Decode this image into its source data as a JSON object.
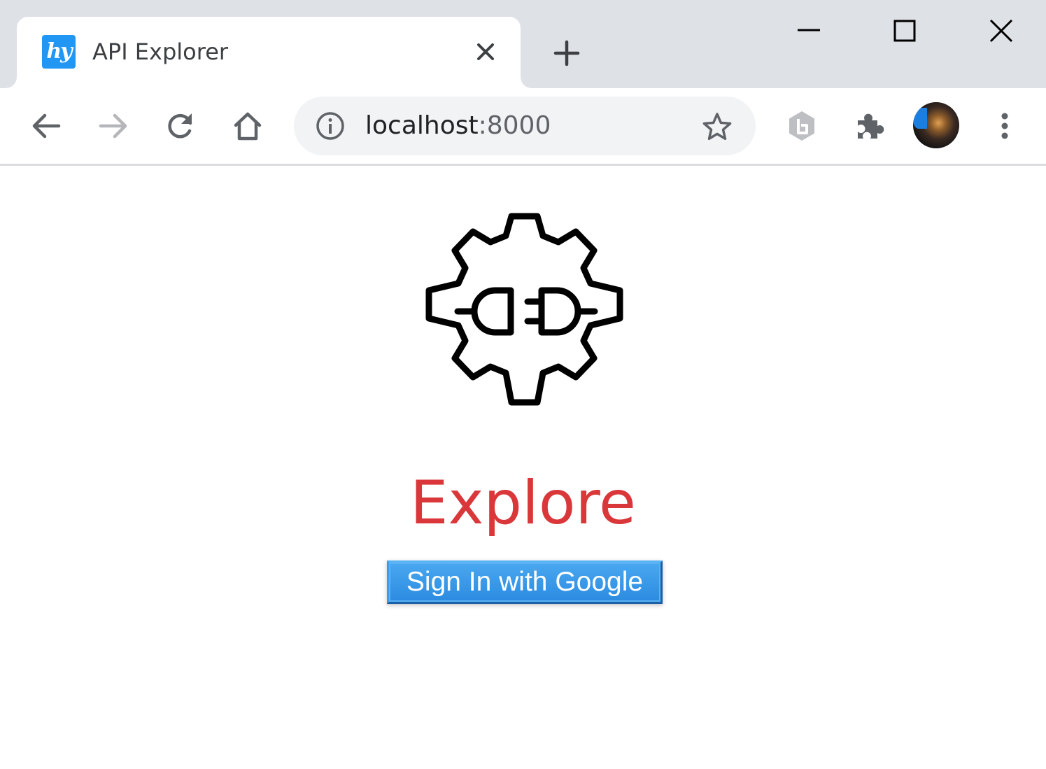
{
  "window": {
    "tab": {
      "title": "API Explorer",
      "favicon_text": "hy",
      "favicon_color": "#2196f3"
    },
    "controls": {
      "minimize_icon": "minimize-icon",
      "maximize_icon": "maximize-icon",
      "close_icon": "close-icon",
      "new_tab_icon": "plus-icon"
    }
  },
  "toolbar": {
    "back_icon": "arrow-left-icon",
    "forward_icon": "arrow-right-icon",
    "reload_icon": "reload-icon",
    "home_icon": "home-icon",
    "address": {
      "host": "localhost",
      "port": ":8000",
      "info_icon": "info-icon",
      "bookmark_icon": "star-icon"
    },
    "extensions": [
      "hexagon-extension-icon",
      "puzzle-icon"
    ],
    "menu_icon": "kebab-menu-icon"
  },
  "page": {
    "logo_icon": "gear-plug-icon",
    "heading": "Explore",
    "heading_color": "#d9373a",
    "signin_label": "Sign In with Google",
    "signin_color": "#2b8be0"
  }
}
